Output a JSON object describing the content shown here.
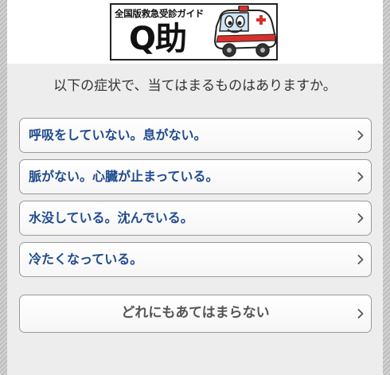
{
  "header": {
    "logo_subtitle": "全国版救急受診ガイド",
    "logo_title": "Q助",
    "mascot_icon": "ambulance-mascot-icon"
  },
  "question": "以下の症状で、当てはまるものはありますか。",
  "options": [
    {
      "label": "呼吸をしていない。息がない。",
      "icon": "chevron-right-icon"
    },
    {
      "label": "脈がない。心臓が止まっている。",
      "icon": "chevron-right-icon"
    },
    {
      "label": "水没している。沈んでいる。",
      "icon": "chevron-right-icon"
    },
    {
      "label": "冷たくなっている。",
      "icon": "chevron-right-icon"
    }
  ],
  "none_option": {
    "label": "どれにもあてはまらない",
    "icon": "chevron-right-icon"
  },
  "colors": {
    "option_text": "#1f4a8f",
    "none_text": "#555555",
    "panel_bg": "#ededed",
    "border": "#9a9a9a",
    "mascot_red": "#d9302c"
  }
}
